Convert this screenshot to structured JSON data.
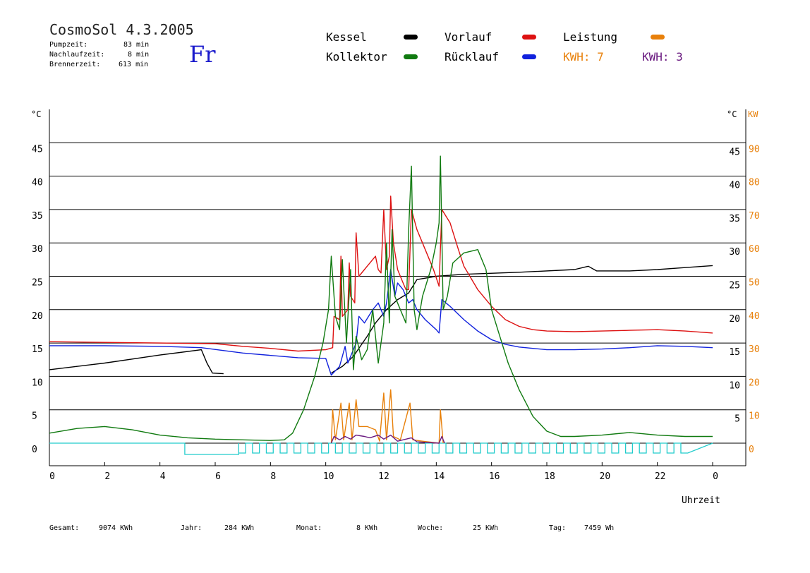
{
  "header": {
    "title": "CosmoSol 4.3.2005",
    "day": "Fr",
    "stats": [
      {
        "label": "Pumpzeit:",
        "value": "83 min"
      },
      {
        "label": "Nachlaufzeit:",
        "value": "8 min"
      },
      {
        "label": "Brennerzeit:",
        "value": "613 min"
      }
    ]
  },
  "legend": {
    "kessel": {
      "label": "Kessel",
      "color": "#000000"
    },
    "kollektor": {
      "label": "Kollektor",
      "color": "#107a10"
    },
    "vorlauf": {
      "label": "Vorlauf",
      "color": "#dd1111"
    },
    "ruecklauf": {
      "label": "Rücklauf",
      "color": "#1122dd"
    },
    "leistung": {
      "label": "Leistung",
      "color": "#e8800a"
    },
    "kwh1": "KWH: 7",
    "kwh2": "KWH: 3"
  },
  "axes": {
    "left_unit": "°C",
    "right_unit_c": "°C",
    "right_unit_kw": "KW",
    "x_label": "Uhrzeit"
  },
  "footer": [
    {
      "label": "Gesamt:",
      "value": "9074 KWh"
    },
    {
      "label": "Jahr:",
      "value": "284 KWh"
    },
    {
      "label": "Monat:",
      "value": "8 KWh"
    },
    {
      "label": "Woche:",
      "value": "25 KWh"
    },
    {
      "label": "Tag:",
      "value": "7459 Wh"
    }
  ],
  "chart_data": {
    "type": "line",
    "title": "CosmoSol 4.3.2005",
    "xlabel": "Uhrzeit",
    "ylabel": "°C",
    "y2label": "KW",
    "xlim": [
      0,
      24
    ],
    "ylim": [
      0,
      50
    ],
    "y2lim": [
      0,
      100
    ],
    "x_ticks": [
      "0",
      "2",
      "4",
      "6",
      "8",
      "10",
      "12",
      "14",
      "16",
      "18",
      "20",
      "22",
      "0"
    ],
    "y_ticks_left": [
      "0",
      "5",
      "10",
      "15",
      "20",
      "25",
      "30",
      "35",
      "40",
      "45"
    ],
    "y_ticks_right_c": [
      "5",
      "10",
      "15",
      "20",
      "25",
      "30",
      "35",
      "40",
      "45"
    ],
    "y_ticks_right_kw": [
      "0",
      "10",
      "20",
      "30",
      "40",
      "50",
      "60",
      "70",
      "80",
      "90"
    ],
    "grid": true,
    "series": [
      {
        "name": "Kessel",
        "color": "#000000",
        "points": [
          [
            0,
            11
          ],
          [
            2,
            12
          ],
          [
            4,
            13.2
          ],
          [
            5.5,
            14
          ],
          [
            5.7,
            12
          ],
          [
            5.9,
            10.5
          ],
          [
            6.3,
            10.4
          ]
        ]
      },
      {
        "name": "Kessel",
        "color": "#000000",
        "points": [
          [
            10.2,
            10.5
          ],
          [
            10.6,
            11.5
          ],
          [
            11,
            13
          ],
          [
            11.5,
            16
          ],
          [
            11.8,
            18
          ],
          [
            12.2,
            20
          ],
          [
            12.6,
            21.5
          ],
          [
            13,
            22.5
          ],
          [
            13.3,
            24.5
          ],
          [
            14,
            25
          ],
          [
            15,
            25.3
          ],
          [
            17,
            25.6
          ],
          [
            19,
            26
          ],
          [
            19.5,
            26.5
          ],
          [
            19.8,
            25.8
          ],
          [
            21,
            25.8
          ],
          [
            22,
            26
          ],
          [
            23,
            26.3
          ],
          [
            24,
            26.6
          ]
        ]
      },
      {
        "name": "Vorlauf",
        "color": "#dd1111",
        "points": [
          [
            0,
            15.2
          ],
          [
            2,
            15.1
          ],
          [
            4,
            15
          ],
          [
            6,
            14.9
          ],
          [
            7,
            14.5
          ],
          [
            8,
            14.2
          ],
          [
            9,
            13.8
          ],
          [
            10,
            14
          ],
          [
            10.25,
            14.3
          ],
          [
            10.3,
            19
          ],
          [
            10.5,
            18.5
          ],
          [
            10.55,
            28
          ],
          [
            10.6,
            19
          ],
          [
            10.8,
            20
          ],
          [
            10.85,
            27
          ],
          [
            10.9,
            22
          ],
          [
            11.05,
            21
          ],
          [
            11.1,
            31.5
          ],
          [
            11.2,
            25
          ],
          [
            11.4,
            26
          ],
          [
            11.6,
            27
          ],
          [
            11.8,
            28
          ],
          [
            11.9,
            26
          ],
          [
            12.0,
            25.5
          ],
          [
            12.1,
            35
          ],
          [
            12.2,
            26
          ],
          [
            12.3,
            28
          ],
          [
            12.35,
            37
          ],
          [
            12.45,
            30
          ],
          [
            12.6,
            26
          ],
          [
            12.8,
            24
          ],
          [
            12.9,
            23
          ],
          [
            13.0,
            23
          ],
          [
            13.1,
            35
          ],
          [
            13.3,
            32
          ],
          [
            13.6,
            29
          ],
          [
            13.9,
            26
          ],
          [
            14.1,
            23.5
          ],
          [
            14.2,
            35
          ],
          [
            14.5,
            33
          ],
          [
            14.8,
            29
          ],
          [
            15,
            26.5
          ],
          [
            15.5,
            23
          ],
          [
            16,
            20.5
          ],
          [
            16.5,
            18.5
          ],
          [
            17,
            17.5
          ],
          [
            17.5,
            17
          ],
          [
            18,
            16.8
          ],
          [
            19,
            16.7
          ],
          [
            20,
            16.8
          ],
          [
            21,
            16.9
          ],
          [
            22,
            17
          ],
          [
            23,
            16.8
          ],
          [
            24,
            16.5
          ]
        ]
      },
      {
        "name": "Rücklauf",
        "color": "#1122dd",
        "points": [
          [
            0,
            14.6
          ],
          [
            2,
            14.6
          ],
          [
            4,
            14.5
          ],
          [
            5.5,
            14.3
          ],
          [
            7,
            13.5
          ],
          [
            9,
            12.8
          ],
          [
            10,
            12.7
          ],
          [
            10.2,
            10.2
          ],
          [
            10.5,
            11.5
          ],
          [
            10.7,
            14.5
          ],
          [
            10.8,
            12
          ],
          [
            11.1,
            15
          ],
          [
            11.2,
            19
          ],
          [
            11.4,
            18
          ],
          [
            11.7,
            20
          ],
          [
            11.9,
            21
          ],
          [
            12.1,
            19
          ],
          [
            12.2,
            21
          ],
          [
            12.35,
            26
          ],
          [
            12.5,
            22
          ],
          [
            12.6,
            24
          ],
          [
            12.8,
            23
          ],
          [
            13.0,
            21
          ],
          [
            13.15,
            21.5
          ],
          [
            13.3,
            20
          ],
          [
            13.6,
            18.5
          ],
          [
            14.0,
            17
          ],
          [
            14.1,
            16.5
          ],
          [
            14.2,
            21.5
          ],
          [
            14.5,
            20.5
          ],
          [
            15,
            18.5
          ],
          [
            15.5,
            16.8
          ],
          [
            16,
            15.5
          ],
          [
            16.5,
            14.8
          ],
          [
            17,
            14.4
          ],
          [
            18,
            14
          ],
          [
            19,
            14
          ],
          [
            20,
            14.1
          ],
          [
            21,
            14.3
          ],
          [
            22,
            14.6
          ],
          [
            23,
            14.5
          ],
          [
            24,
            14.3
          ]
        ]
      },
      {
        "name": "Kollektor",
        "color": "#107a10",
        "points": [
          [
            0,
            1.5
          ],
          [
            1,
            2.2
          ],
          [
            2,
            2.5
          ],
          [
            3,
            2
          ],
          [
            4,
            1.2
          ],
          [
            5,
            0.8
          ],
          [
            6,
            0.6
          ],
          [
            7,
            0.5
          ],
          [
            8,
            0.4
          ],
          [
            8.5,
            0.5
          ],
          [
            8.8,
            1.5
          ],
          [
            9.2,
            5
          ],
          [
            9.6,
            10
          ],
          [
            9.9,
            15
          ],
          [
            10.1,
            20
          ],
          [
            10.2,
            28
          ],
          [
            10.35,
            19
          ],
          [
            10.5,
            17
          ],
          [
            10.6,
            27.5
          ],
          [
            10.75,
            15
          ],
          [
            10.9,
            26
          ],
          [
            11.0,
            11
          ],
          [
            11.1,
            16
          ],
          [
            11.3,
            12.5
          ],
          [
            11.5,
            14
          ],
          [
            11.7,
            20
          ],
          [
            11.9,
            12
          ],
          [
            12.1,
            18
          ],
          [
            12.2,
            30
          ],
          [
            12.3,
            18
          ],
          [
            12.4,
            32
          ],
          [
            12.5,
            22
          ],
          [
            12.7,
            20
          ],
          [
            12.9,
            18
          ],
          [
            13.0,
            32
          ],
          [
            13.1,
            41.5
          ],
          [
            13.2,
            20
          ],
          [
            13.3,
            17
          ],
          [
            13.5,
            22
          ],
          [
            13.8,
            26
          ],
          [
            14.0,
            30
          ],
          [
            14.1,
            33
          ],
          [
            14.15,
            43
          ],
          [
            14.25,
            20
          ],
          [
            14.4,
            22
          ],
          [
            14.6,
            27
          ],
          [
            15,
            28.5
          ],
          [
            15.5,
            29
          ],
          [
            15.8,
            26
          ],
          [
            16.0,
            20
          ],
          [
            16.3,
            16
          ],
          [
            16.6,
            12
          ],
          [
            17,
            8
          ],
          [
            17.5,
            4
          ],
          [
            18,
            1.8
          ],
          [
            18.5,
            1
          ],
          [
            19,
            1
          ],
          [
            20,
            1.2
          ],
          [
            21,
            1.6
          ],
          [
            22,
            1.2
          ],
          [
            23,
            1
          ],
          [
            24,
            1
          ]
        ]
      },
      {
        "name": "Leistung",
        "color": "#e8800a",
        "points": [
          [
            10.2,
            0
          ],
          [
            10.25,
            5
          ],
          [
            10.35,
            0.5
          ],
          [
            10.55,
            6
          ],
          [
            10.65,
            0.5
          ],
          [
            10.85,
            6
          ],
          [
            10.95,
            0.5
          ],
          [
            11.1,
            6.5
          ],
          [
            11.2,
            2.5
          ],
          [
            11.5,
            2.5
          ],
          [
            11.8,
            2
          ],
          [
            11.95,
            0.3
          ],
          [
            12.1,
            7.5
          ],
          [
            12.2,
            0.5
          ],
          [
            12.35,
            8
          ],
          [
            12.45,
            1
          ],
          [
            12.7,
            0.5
          ],
          [
            13.05,
            6
          ],
          [
            13.15,
            0.5
          ],
          [
            13.5,
            0.3
          ],
          [
            14.1,
            0
          ],
          [
            14.15,
            5
          ],
          [
            14.25,
            0
          ]
        ]
      },
      {
        "name": "Leistung",
        "color": "#6a1a80",
        "points": [
          [
            10.2,
            0
          ],
          [
            10.3,
            1
          ],
          [
            10.5,
            0.5
          ],
          [
            10.7,
            1
          ],
          [
            10.9,
            0.6
          ],
          [
            11.1,
            1.2
          ],
          [
            11.4,
            1
          ],
          [
            11.6,
            0.8
          ],
          [
            11.9,
            1.2
          ],
          [
            12.1,
            0.6
          ],
          [
            12.35,
            1.2
          ],
          [
            12.6,
            0.3
          ],
          [
            13.1,
            0.8
          ],
          [
            13.3,
            0.2
          ],
          [
            14.1,
            0
          ],
          [
            14.2,
            1
          ],
          [
            14.3,
            0
          ]
        ]
      }
    ],
    "pump_segments": [
      [
        4.9,
        6.85
      ],
      [
        6.85,
        23.1
      ]
    ]
  }
}
